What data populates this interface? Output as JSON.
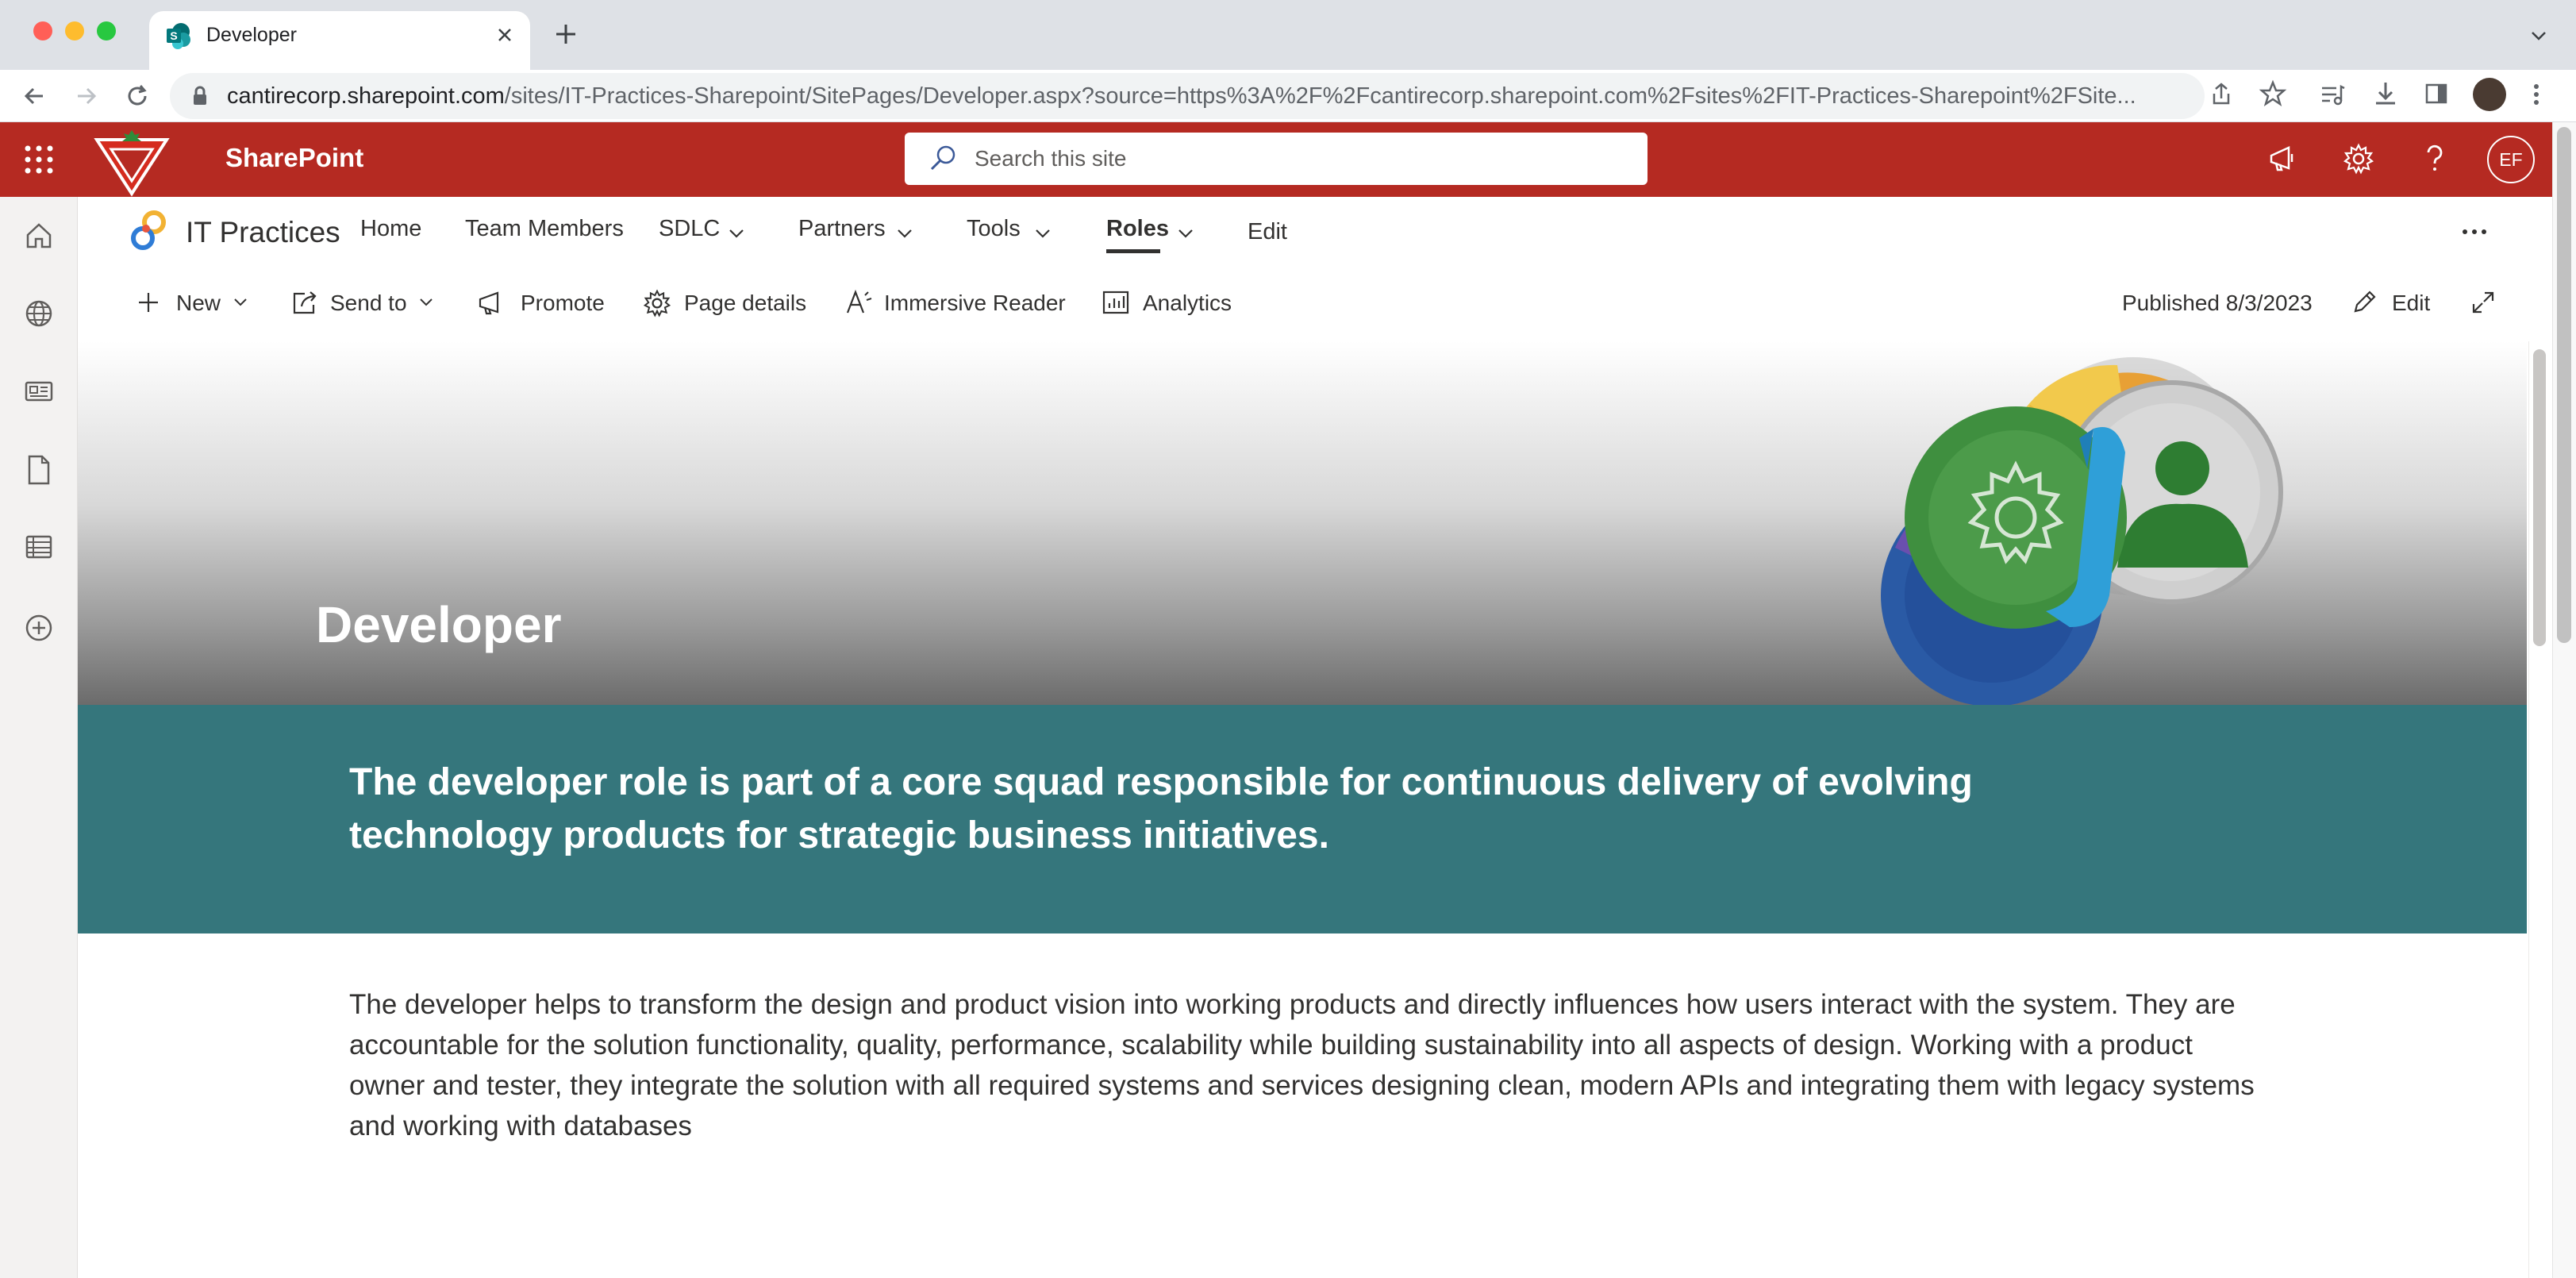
{
  "browser": {
    "tab_title": "Developer",
    "url_host": "cantirecorp.sharepoint.com",
    "url_rest": "/sites/IT-Practices-Sharepoint/SitePages/Developer.aspx?source=https%3A%2F%2Fcantirecorp.sharepoint.com%2Fsites%2FIT-Practices-Sharepoint%2FSite..."
  },
  "suitebar": {
    "app_name": "SharePoint",
    "search_placeholder": "Search this site",
    "avatar_initials": "EF",
    "color": "#b52a22"
  },
  "site": {
    "title": "IT Practices",
    "nav": [
      {
        "label": "Home"
      },
      {
        "label": "Team Members"
      },
      {
        "label": "SDLC"
      },
      {
        "label": "Partners"
      },
      {
        "label": "Tools"
      },
      {
        "label": "Roles"
      },
      {
        "label": "Edit"
      }
    ]
  },
  "commandbar": {
    "new": "New",
    "send_to": "Send to",
    "promote": "Promote",
    "page_details": "Page details",
    "immersive_reader": "Immersive Reader",
    "analytics": "Analytics",
    "published": "Published 8/3/2023",
    "edit": "Edit"
  },
  "page": {
    "title": "Developer",
    "banner_text": "The developer role is part of a core squad responsible for continuous delivery of evolving technology products for strategic business initiatives.",
    "body_text": "The developer helps to transform the design and product vision into working products and directly influences how users interact with the system. They are accountable for the solution functionality, quality, performance, scalability while building sustainability into all aspects of design. Working with a product owner and tester, they integrate the solution with all required systems and services designing clean, modern APIs and integrating them with legacy systems and working with databases",
    "banner_color": "#35767c"
  }
}
